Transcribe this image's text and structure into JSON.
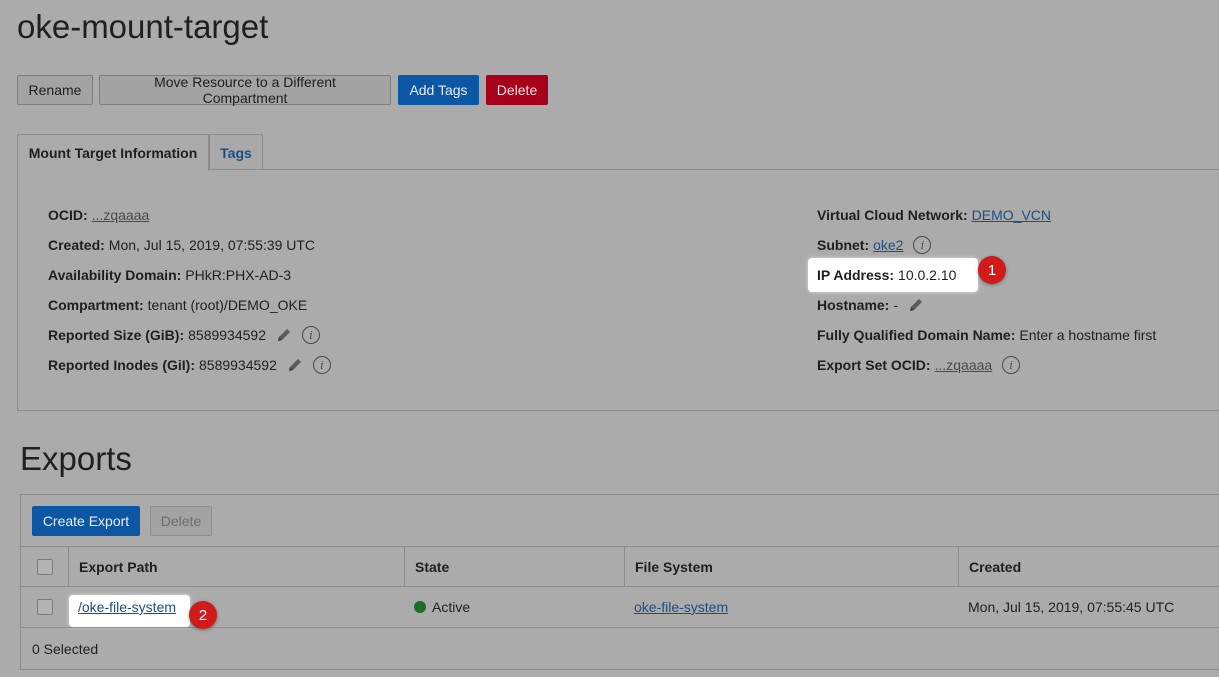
{
  "page": {
    "title": "oke-mount-target"
  },
  "actions": {
    "rename": "Rename",
    "move": "Move Resource to a Different Compartment",
    "add_tags": "Add Tags",
    "delete": "Delete"
  },
  "tabs": [
    {
      "label": "Mount Target Information",
      "active": true
    },
    {
      "label": "Tags",
      "active": false
    }
  ],
  "info": {
    "left": [
      {
        "key": "OCID:",
        "value": "...zqaaaa",
        "kind": "link-muted"
      },
      {
        "key": "Created:",
        "value": "Mon, Jul 15, 2019, 07:55:39 UTC"
      },
      {
        "key": "Availability Domain:",
        "value": "PHkR:PHX-AD-3"
      },
      {
        "key": "Compartment:",
        "value": "tenant (root)/DEMO_OKE"
      },
      {
        "key": "Reported Size (GiB):",
        "value": "8589934592"
      },
      {
        "key": "Reported Inodes (GiI):",
        "value": "8589934592"
      }
    ],
    "right": [
      {
        "key": "Virtual Cloud Network:",
        "value": "DEMO_VCN"
      },
      {
        "key": "Subnet:",
        "value": "oke2"
      },
      {
        "key": "IP Address:",
        "value": "10.0.2.10"
      },
      {
        "key": "Hostname:",
        "value": "-"
      },
      {
        "key": "Fully Qualified Domain Name:",
        "value": "Enter a hostname first"
      },
      {
        "key": "Export Set OCID:",
        "value": "...zqaaaa"
      }
    ]
  },
  "callouts": [
    "1",
    "2"
  ],
  "exports": {
    "title": "Exports",
    "create_label": "Create Export",
    "delete_label": "Delete",
    "columns": [
      "Export Path",
      "State",
      "File System",
      "Created"
    ],
    "rows": [
      {
        "path": "/oke-file-system",
        "state": "Active",
        "file_system": "oke-file-system",
        "created": "Mon, Jul 15, 2019, 07:55:45 UTC"
      }
    ],
    "selected_text": "0 Selected"
  },
  "colors": {
    "primary": "#0c57a4",
    "danger": "#a6001a",
    "active": "#1b6d27",
    "callout": "#d11b1b"
  }
}
